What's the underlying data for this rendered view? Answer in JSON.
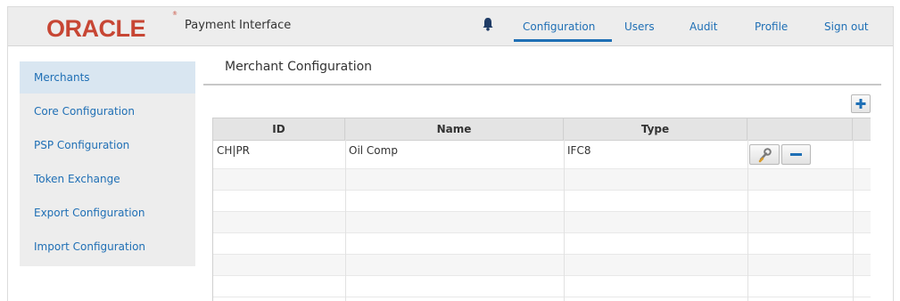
{
  "header": {
    "logo_text": "ORACLE",
    "logo_mark": "®",
    "app_name": "Payment Interface",
    "notification_icon": "bell-icon",
    "nav": [
      {
        "label": "Configuration",
        "active": true
      },
      {
        "label": "Users",
        "active": false
      },
      {
        "label": "Audit",
        "active": false
      },
      {
        "label": "Profile",
        "active": false
      },
      {
        "label": "Sign out",
        "active": false
      }
    ]
  },
  "sidebar": {
    "items": [
      {
        "label": "Merchants",
        "active": true
      },
      {
        "label": "Core Configuration",
        "active": false
      },
      {
        "label": "PSP Configuration",
        "active": false
      },
      {
        "label": "Token Exchange",
        "active": false
      },
      {
        "label": "Export Configuration",
        "active": false
      },
      {
        "label": "Import Configuration",
        "active": false
      }
    ]
  },
  "main": {
    "title": "Merchant Configuration",
    "add_icon": "plus-icon",
    "table": {
      "columns": [
        "ID",
        "Name",
        "Type"
      ],
      "rows": [
        {
          "id": "CH|PR",
          "name": "Oil Comp",
          "type": "IFC8",
          "edit_icon": "wrench-icon",
          "delete_icon": "minus-icon"
        }
      ]
    }
  },
  "colors": {
    "brand_red": "#c74634",
    "link_blue": "#1f6fb5",
    "underline_blue": "#1f6fb5",
    "header_bg": "#ededed",
    "sidebar_active_bg": "#d9e6f1",
    "table_header_bg": "#e4e4e4"
  }
}
